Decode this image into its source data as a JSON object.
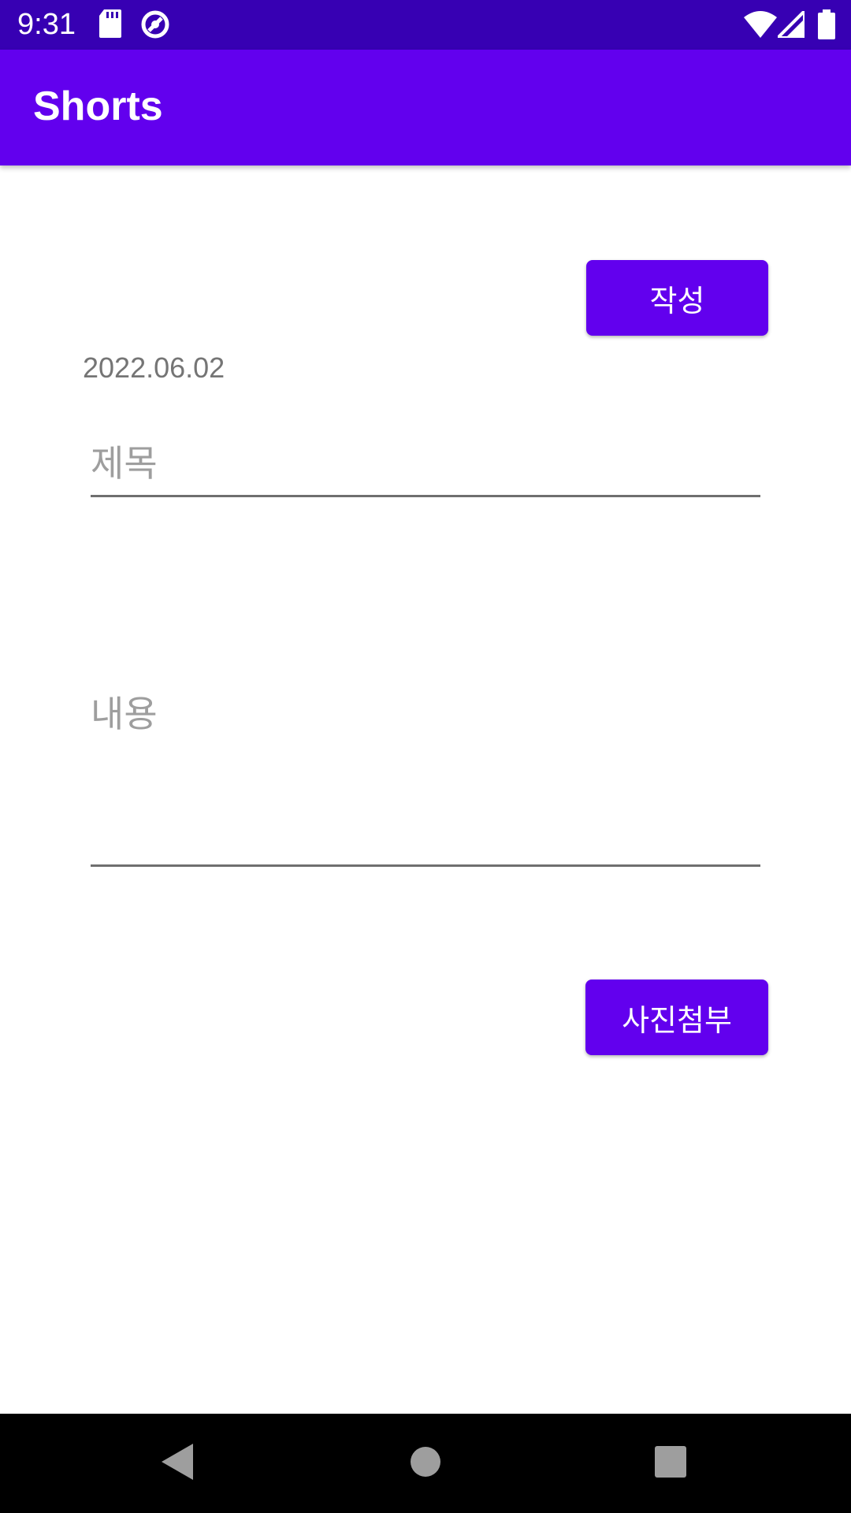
{
  "status_bar": {
    "time": "9:31",
    "icons_left": [
      "sd-card-icon",
      "vpn-icon"
    ],
    "icons_right": [
      "wifi-icon",
      "signal-icon",
      "battery-icon"
    ]
  },
  "app_bar": {
    "title": "Shorts"
  },
  "form": {
    "write_button_label": "작성",
    "date": "2022.06.02",
    "title_placeholder": "제목",
    "title_value": "",
    "content_placeholder": "내용",
    "content_value": "",
    "attach_photo_button_label": "사진첨부"
  },
  "nav_bar": {
    "buttons": [
      "back-icon",
      "home-icon",
      "recents-icon"
    ]
  },
  "colors": {
    "status_bar": "#3700B3",
    "primary": "#6200EE",
    "nav_bar": "#000000"
  }
}
